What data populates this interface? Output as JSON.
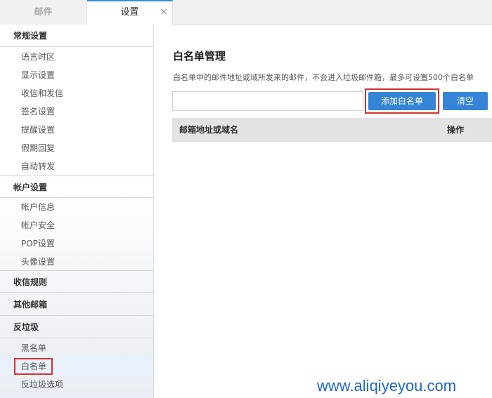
{
  "tabs": {
    "mail": "邮件",
    "settings": "设置",
    "close": "×"
  },
  "sidebar": {
    "general": {
      "header": "常规设置",
      "items": [
        "语言时区",
        "显示设置",
        "收信和发信",
        "签名设置",
        "提醒设置",
        "假期回复",
        "自动转发"
      ]
    },
    "account": {
      "header": "帐户设置",
      "items": [
        "帐户信息",
        "帐户安全",
        "POP设置",
        "头像设置"
      ]
    },
    "rules": {
      "header": "收信规则"
    },
    "other": {
      "header": "其他邮箱"
    },
    "spam": {
      "header": "反垃圾",
      "items": [
        "黑名单",
        "白名单",
        "反垃圾选项"
      ],
      "selected": "白名单"
    }
  },
  "main": {
    "title": "白名单管理",
    "description": "白名单中的邮件地址或域所发来的邮件，不会进入垃圾邮件箱，最多可设置500个白名单",
    "input_value": "",
    "add_button": "添加白名单",
    "clear_button": "清空",
    "table": {
      "col_address": "邮箱地址或域名",
      "col_ops": "操作"
    }
  },
  "watermark": "www.aliqiyeyou.com",
  "colors": {
    "accent": "#3584d6",
    "highlight_box": "#d9302f",
    "watermark": "#1f66c8"
  }
}
